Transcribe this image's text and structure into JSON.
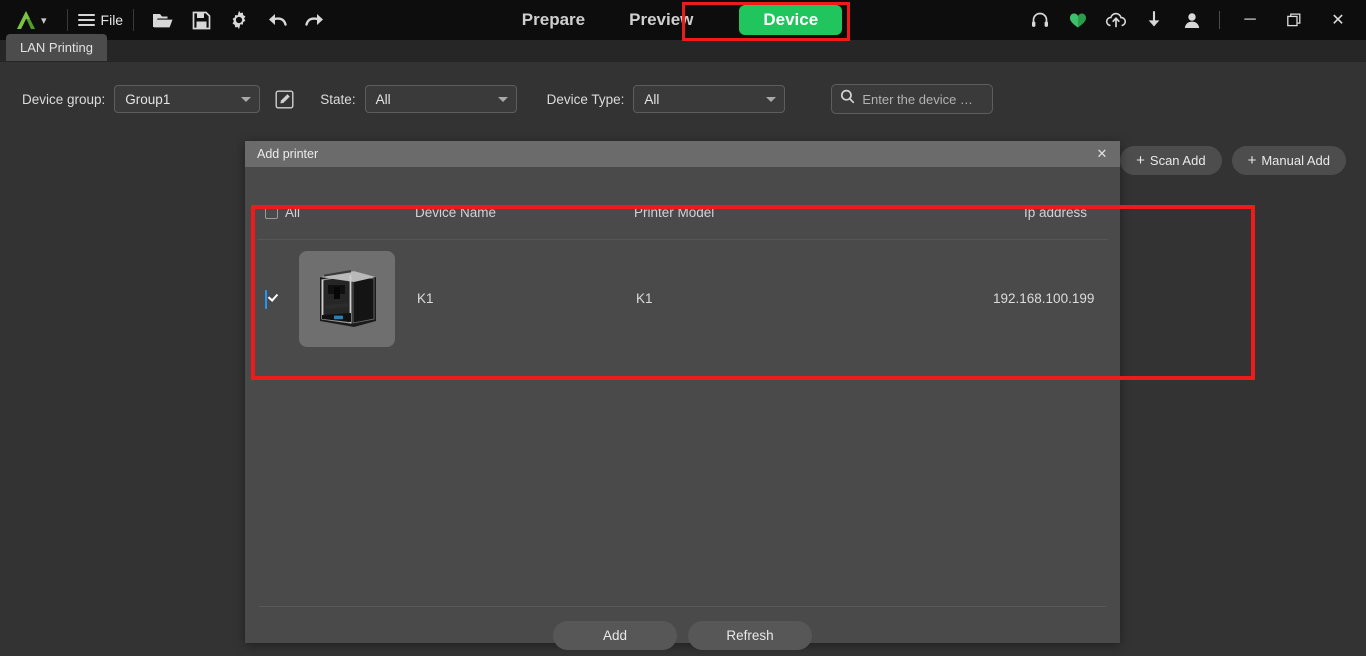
{
  "window": {
    "title_bar": {
      "logo": "app-logo-a",
      "logo_caret": "chevron-down-icon",
      "menu_icon": "hamburger-icon",
      "file_label": "File",
      "tools": [
        {
          "name": "open-folder-icon"
        },
        {
          "name": "save-icon"
        },
        {
          "name": "settings-gear-icon"
        },
        {
          "name": "undo-icon"
        },
        {
          "name": "redo-icon"
        }
      ],
      "tabs": [
        {
          "label": "Prepare",
          "active": false
        },
        {
          "label": "Preview",
          "active": false
        },
        {
          "label": "Device",
          "active": true
        }
      ],
      "right_icons": [
        {
          "name": "headset-icon"
        },
        {
          "name": "heart-icon"
        },
        {
          "name": "cloud-upload-icon"
        },
        {
          "name": "download-icon"
        },
        {
          "name": "user-account-icon"
        }
      ],
      "window_controls": [
        {
          "name": "minimize-button",
          "glyph": "─"
        },
        {
          "name": "maximize-button",
          "glyph": "❐"
        },
        {
          "name": "close-button",
          "glyph": "✕"
        }
      ]
    },
    "sub_tab": {
      "label": "LAN Printing"
    }
  },
  "filters": {
    "device_group": {
      "label": "Device group:",
      "value": "Group1"
    },
    "edit_group_icon": "edit-pencil-icon",
    "state": {
      "label": "State:",
      "value": "All"
    },
    "device_type": {
      "label": "Device Type:",
      "value": "All"
    },
    "search": {
      "placeholder": "Enter the device …",
      "value": "",
      "icon": "search-icon"
    },
    "scan_add": {
      "label": "Scan Add",
      "plus": "+"
    },
    "manual_add": {
      "label": "Manual Add",
      "plus": "+"
    }
  },
  "dialog": {
    "title": "Add printer",
    "close_glyph": "✕",
    "columns": {
      "all": "All",
      "device_name": "Device Name",
      "printer_model": "Printer Model",
      "ip_address": "Ip address"
    },
    "all_checked": false,
    "rows": [
      {
        "checked": true,
        "thumbnail": "printer-thumbnail",
        "device_name": "K1",
        "printer_model": "K1",
        "ip_address": "192.168.100.199"
      }
    ],
    "buttons": {
      "add": "Add",
      "refresh": "Refresh"
    }
  },
  "annotations": [
    {
      "name": "device-tab-highlight",
      "color": "#ee1b1b"
    },
    {
      "name": "device-row-highlight",
      "color": "#ee1b1b"
    }
  ],
  "colors": {
    "accent_green": "#21c55d",
    "annotation_red": "#ee1b1b",
    "checkbox_blue": "#2196f3",
    "titlebar_bg": "#0d0d0d",
    "app_bg": "#333333",
    "dialog_bg": "#4a4a4a",
    "dialog_title_bg": "#6b6b6b"
  }
}
